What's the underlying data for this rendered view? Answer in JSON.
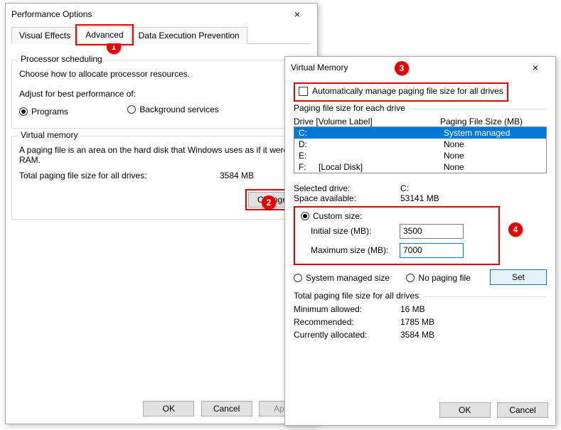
{
  "perf": {
    "title": "Performance Options",
    "tabs": {
      "visual": "Visual Effects",
      "advanced": "Advanced",
      "dep": "Data Execution Prevention"
    },
    "proc": {
      "legend": "Processor scheduling",
      "desc": "Choose how to allocate processor resources.",
      "adjust": "Adjust for best performance of:",
      "programs": "Programs",
      "bg": "Background services"
    },
    "vm": {
      "legend": "Virtual memory",
      "desc": "A paging file is an area on the hard disk that Windows uses as if it were RAM.",
      "totalLabel": "Total paging file size for all drives:",
      "totalValue": "3584 MB",
      "change": "Change..."
    },
    "buttons": {
      "ok": "OK",
      "cancel": "Cancel",
      "apply": "Apply"
    }
  },
  "vmem": {
    "title": "Virtual Memory",
    "auto": "Automatically manage paging file size for all drives",
    "eachLegend": "Paging file size for each drive",
    "colDrive": "Drive  [Volume Label]",
    "colSize": "Paging File Size (MB)",
    "drives": {
      "c": {
        "label": "C:",
        "vol": "",
        "size": "System managed"
      },
      "d": {
        "label": "D:",
        "vol": "",
        "size": "None"
      },
      "e": {
        "label": "E:",
        "vol": "",
        "size": "None"
      },
      "f": {
        "label": "F:",
        "vol": "[Local Disk]",
        "size": "None"
      }
    },
    "selDriveLabel": "Selected drive:",
    "selDriveValue": "C:",
    "spaceLabel": "Space available:",
    "spaceValue": "53141 MB",
    "custom": "Custom size:",
    "initLabel": "Initial size (MB):",
    "initValue": "3500",
    "maxLabel": "Maximum size (MB):",
    "maxValue": "7000",
    "sys": "System managed size",
    "none": "No paging file",
    "set": "Set",
    "totalsLegend": "Total paging file size for all drives",
    "minLabel": "Minimum allowed:",
    "minValue": "16 MB",
    "recLabel": "Recommended:",
    "recValue": "1785 MB",
    "curLabel": "Currently allocated:",
    "curValue": "3584 MB",
    "ok": "OK",
    "cancel": "Cancel"
  }
}
